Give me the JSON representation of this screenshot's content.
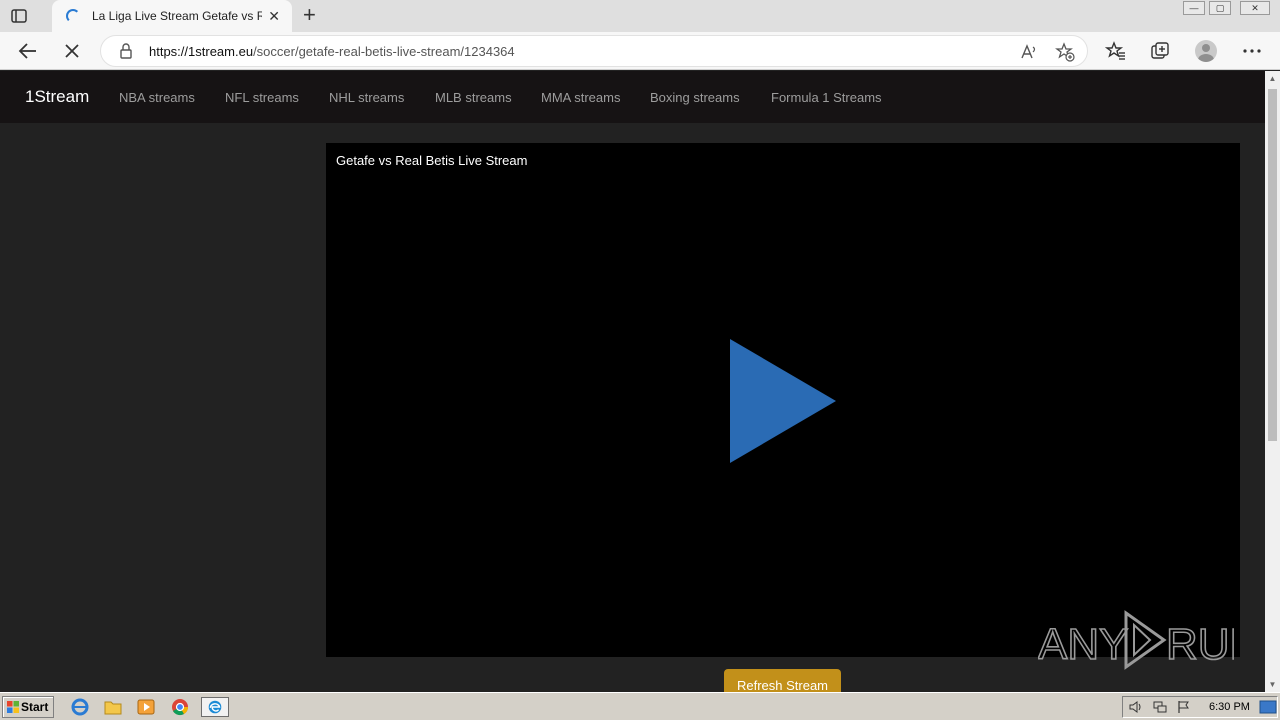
{
  "browser": {
    "tab_title": "La Liga Live Stream Getafe vs Real Betis",
    "tab_close": "✕",
    "new_tab": "+",
    "url_host": "https://1stream.eu",
    "url_path": "/soccer/getafe-real-betis-live-stream/1234364",
    "window_controls": {
      "minimize": "—",
      "restore": "▢",
      "close": "✕"
    }
  },
  "site": {
    "brand": "1Stream",
    "nav": [
      {
        "label": "NBA streams"
      },
      {
        "label": "NFL streams"
      },
      {
        "label": "NHL streams"
      },
      {
        "label": "MLB streams"
      },
      {
        "label": "MMA streams"
      },
      {
        "label": "Boxing streams"
      },
      {
        "label": "Formula 1 Streams"
      }
    ]
  },
  "player": {
    "title": "Getafe vs Real Betis Live Stream",
    "play_color": "#2a6bb4"
  },
  "refresh_button": "Refresh Stream",
  "watermark": "ANY RUN",
  "taskbar": {
    "start": "Start",
    "clock": "6:30 PM"
  }
}
